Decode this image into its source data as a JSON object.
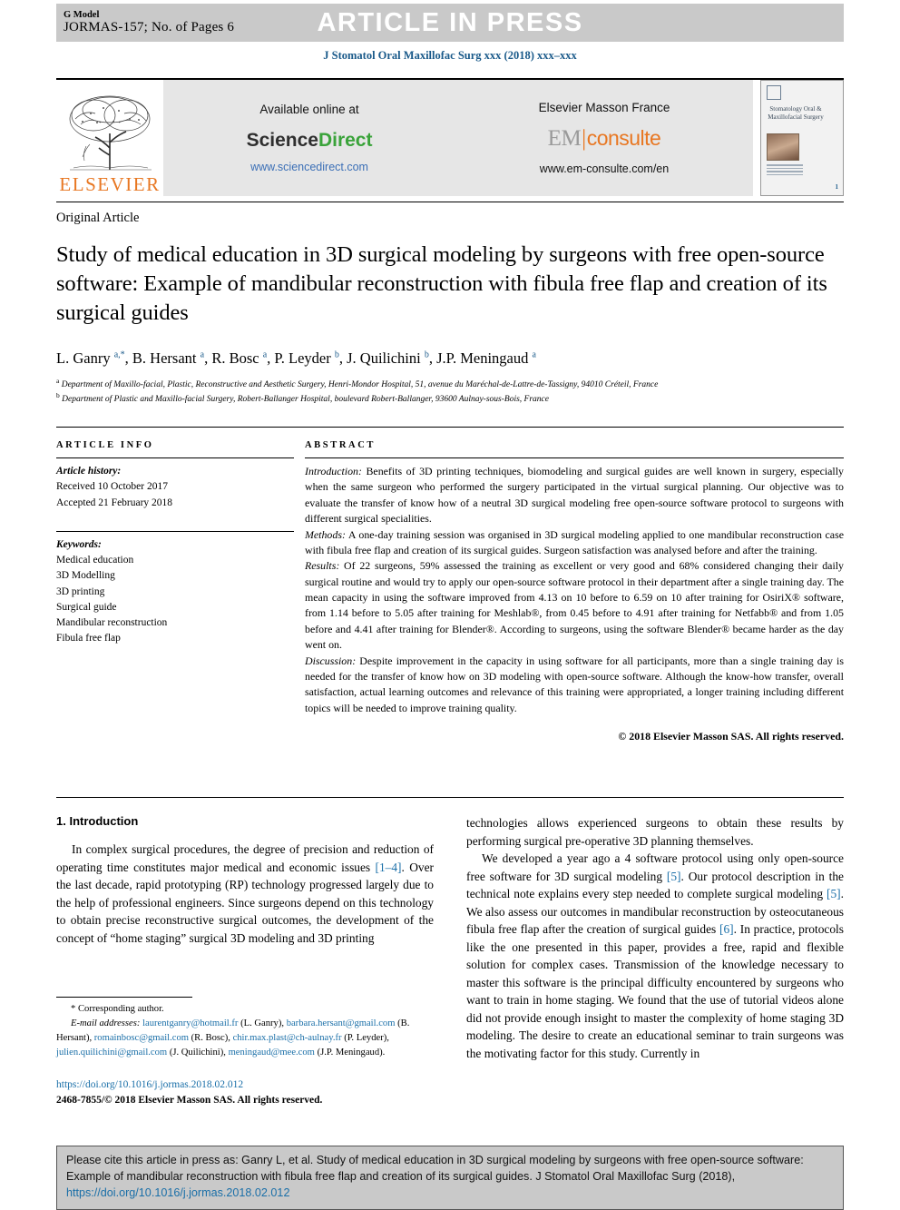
{
  "header": {
    "g_model_label": "G Model",
    "manuscript_id": "JORMAS-157; No. of Pages 6",
    "article_in_press": "ARTICLE IN PRESS",
    "journal_ref": "J Stomatol Oral Maxillofac Surg xxx (2018) xxx–xxx"
  },
  "masthead": {
    "elsevier_wordmark": "ELSEVIER",
    "available_online_at": "Available online at",
    "sciencedirect_part1": "Science",
    "sciencedirect_part2": "Direct",
    "sciencedirect_url": "www.sciencedirect.com",
    "publisher": "Elsevier Masson France",
    "em_part1": "EM",
    "em_part2": "consulte",
    "em_url": "www.em-consulte.com/en",
    "cover_title": "Stomatology Oral & Maxillofacial Surgery",
    "cover_badge": "1"
  },
  "article": {
    "type": "Original Article",
    "title": "Study of medical education in 3D surgical modeling by surgeons with free open-source software: Example of mandibular reconstruction with fibula free flap and creation of its surgical guides",
    "authors_html": "L. Ganry <sup>a,*</sup>, B. Hersant <sup>a</sup>, R. Bosc <sup>a</sup>, P. Leyder <sup>b</sup>, J. Quilichini <sup>b</sup>, J.P. Meningaud <sup>a</sup>",
    "affiliation_a": "Department of Maxillo-facial, Plastic, Reconstructive and Aesthetic Surgery, Henri-Mondor Hospital, 51, avenue du Maréchal-de-Lattre-de-Tassigny, 94010 Créteil, France",
    "affiliation_b": "Department of Plastic and Maxillo-facial Surgery, Robert-Ballanger Hospital, boulevard Robert-Ballanger, 93600 Aulnay-sous-Bois, France"
  },
  "article_info": {
    "heading": "ARTICLE INFO",
    "history_label": "Article history:",
    "received": "Received 10 October 2017",
    "accepted": "Accepted 21 February 2018",
    "keywords_label": "Keywords:",
    "keywords": [
      "Medical education",
      "3D Modelling",
      "3D printing",
      "Surgical guide",
      "Mandibular reconstruction",
      "Fibula free flap"
    ]
  },
  "abstract": {
    "heading": "ABSTRACT",
    "introduction_label": "Introduction:",
    "introduction_text": " Benefits of 3D printing techniques, biomodeling and surgical guides are well known in surgery, especially when the same surgeon who performed the surgery participated in the virtual surgical planning. Our objective was to evaluate the transfer of know how of a neutral 3D surgical modeling free open-source software protocol to surgeons with different surgical specialities.",
    "methods_label": "Methods:",
    "methods_text": " A one-day training session was organised in 3D surgical modeling applied to one mandibular reconstruction case with fibula free flap and creation of its surgical guides. Surgeon satisfaction was analysed before and after the training.",
    "results_label": "Results:",
    "results_text": " Of 22 surgeons, 59% assessed the training as excellent or very good and 68% considered changing their daily surgical routine and would try to apply our open-source software protocol in their department after a single training day. The mean capacity in using the software improved from 4.13 on 10 before to 6.59 on 10 after training for OsiriX® software, from 1.14 before to 5.05 after training for Meshlab®, from 0.45 before to 4.91 after training for Netfabb® and from 1.05 before and 4.41 after training for Blender®. According to surgeons, using the software Blender® became harder as the day went on.",
    "discussion_label": "Discussion:",
    "discussion_text": " Despite improvement in the capacity in using software for all participants, more than a single training day is needed for the transfer of know how on 3D modeling with open-source software. Although the know-how transfer, overall satisfaction, actual learning outcomes and relevance of this training were appropriated, a longer training including different topics will be needed to improve training quality.",
    "copyright": "© 2018 Elsevier Masson SAS. All rights reserved."
  },
  "body": {
    "section_heading": "1. Introduction",
    "left_para_1_a": "In complex surgical procedures, the degree of precision and reduction of operating time constitutes major medical and economic issues ",
    "left_ref_1": "[1–4]",
    "left_para_1_b": ". Over the last decade, rapid prototyping (RP) technology progressed largely due to the help of professional engineers. Since surgeons depend on this technology to obtain precise reconstructive surgical outcomes, the development of the concept of “home staging” surgical 3D modeling and 3D printing",
    "right_para_1": "technologies allows experienced surgeons to obtain these results by performing surgical pre-operative 3D planning themselves.",
    "right_para_2_a": "We developed a year ago a 4 software protocol using only open-source free software for 3D surgical modeling ",
    "right_ref_5a": "[5]",
    "right_para_2_b": ". Our protocol description in the technical note explains every step needed to complete surgical modeling ",
    "right_ref_5b": "[5]",
    "right_para_2_c": ". We also assess our outcomes in mandibular reconstruction by osteocutaneous fibula free flap after the creation of surgical guides ",
    "right_ref_6": "[6]",
    "right_para_2_d": ". In practice, protocols like the one presented in this paper, provides a free, rapid and flexible solution for complex cases. Transmission of the knowledge necessary to master this software is the principal difficulty encountered by surgeons who want to train in home staging. We found that the use of tutorial videos alone did not provide enough insight to master the complexity of home staging 3D modeling. The desire to create an educational seminar to train surgeons was the motivating factor for this study. Currently in"
  },
  "footnote": {
    "corresponding_marker": "*",
    "corresponding_author": "Corresponding author.",
    "email_label": "E-mail addresses:",
    "emails": [
      {
        "address": "laurentganry@hotmail.fr",
        "owner": "(L. Ganry),"
      },
      {
        "address": "barbara.hersant@gmail.com",
        "owner": "(B. Hersant),"
      },
      {
        "address": "romainbosc@gmail.com",
        "owner": "(R. Bosc),"
      },
      {
        "address": "chir.max.plast@ch-aulnay.fr",
        "owner": "(P. Leyder),"
      },
      {
        "address": "julien.quilichini@gmail.com",
        "owner": "(J. Quilichini),"
      },
      {
        "address": "meningaud@mee.com",
        "owner": "(J.P. Meningaud)."
      }
    ],
    "doi": "https://doi.org/10.1016/j.jormas.2018.02.012",
    "issn_line": "2468-7855/© 2018 Elsevier Masson SAS. All rights reserved."
  },
  "citation_box": {
    "text_a": "Please cite this article in press as: Ganry L, et al. Study of medical education in 3D surgical modeling by surgeons with free open-source software: Example of mandibular reconstruction with fibula free flap and creation of its surgical guides. J Stomatol Oral Maxillofac Surg (2018), ",
    "doi_link": "https://doi.org/10.1016/j.jormas.2018.02.012"
  },
  "colors": {
    "link": "#1a6fa8",
    "journal_ref": "#1a5a8a",
    "elsevier_orange": "#e87722",
    "sciencedirect_green": "#3aa33a",
    "grey_bar": "#c9c9c9",
    "banner_grey": "#e6e6e6"
  }
}
